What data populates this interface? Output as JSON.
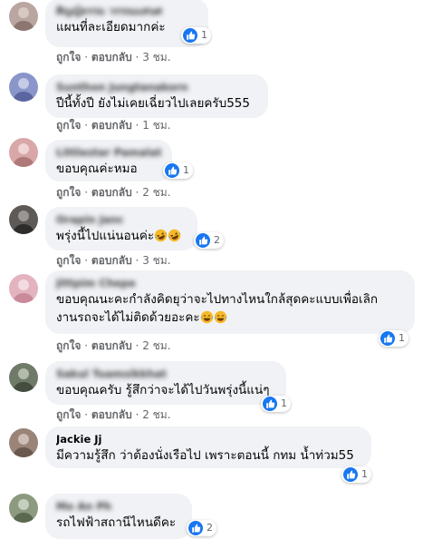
{
  "comments": [
    {
      "author": "ศิญญ์ธรรม วรรณแสนศ",
      "text": "แผนที่ละเอียดมากค่ะ",
      "likes": "1",
      "like_label": "ถูกใจ",
      "reply_label": "ตอบกลับ",
      "time": "3 ชม.",
      "avatar_color": "#b9a6a0"
    },
    {
      "author": "Sunthon Jungtanakorn",
      "text": "ปีนี้ทั้งปี ยังไม่เคยเฉี่ยวไปเลยครับ555",
      "likes": "",
      "like_label": "ถูกใจ",
      "reply_label": "ตอบกลับ",
      "time": "1 ชม.",
      "avatar_color": "#8a95c9"
    },
    {
      "author": "Littlestar Pamalat",
      "text": "ขอบคุณค่ะหมอ",
      "likes": "1",
      "like_label": "ถูกใจ",
      "reply_label": "ตอบกลับ",
      "time": "2 ชม.",
      "avatar_color": "#d9a7a7"
    },
    {
      "author": "Orapin Janc",
      "text": "พรุ่งนี้ไปแน่นอนค่ะ",
      "likes": "2",
      "like_label": "ถูกใจ",
      "reply_label": "ตอบกลับ",
      "time": "3 ชม.",
      "avatar_color": "#5d5a57"
    },
    {
      "author": "Jittpim Chepe",
      "text_line1": "ขอบคุณนะคะกำลังคิดยุว่าจะไปทางไหนใกล้สุดคะแบบเพื่อเลิก",
      "text_line2": "งานรถจะได้ไม่ติดด้วยอะคะ",
      "likes": "1",
      "like_label": "ถูกใจ",
      "reply_label": "ตอบกลับ",
      "time": "2 ชม.",
      "avatar_color": "#e3b4c0"
    },
    {
      "author": "Sakul Tuamsikkhat",
      "text": "ขอบคุณครับ รู้สึกว่าจะได้ไปวันพรุ่งนี้แน่ๆ",
      "likes": "1",
      "like_label": "ถูกใจ",
      "reply_label": "ตอบกลับ",
      "time": "2 ชม.",
      "avatar_color": "#6f7a69"
    },
    {
      "author": "Jackie Jj",
      "text": "มีความรู้สึก ว่าต้องนั่งเรือไป เพราะตอนนี้ กทม น้ำท่วม55",
      "likes": "1",
      "like_label": "ถูกใจ",
      "reply_label": "ตอบกลับ",
      "time": "",
      "avatar_color": "#9a8478"
    },
    {
      "author": "Mo An Ph",
      "text": "รถไฟฟ้าสถานีไหนดีคะ",
      "likes": "2",
      "avatar_color": "#8c9a80"
    }
  ],
  "colors": {
    "bubble": "#f0f2f5",
    "like_blue": "#1877f2",
    "meta_gray": "#65676b"
  },
  "icons": {
    "like": "thumbs-up-icon",
    "emoji_laugh": "rolling-laughing-emoji",
    "emoji_tears": "tears-of-joy-emoji"
  }
}
